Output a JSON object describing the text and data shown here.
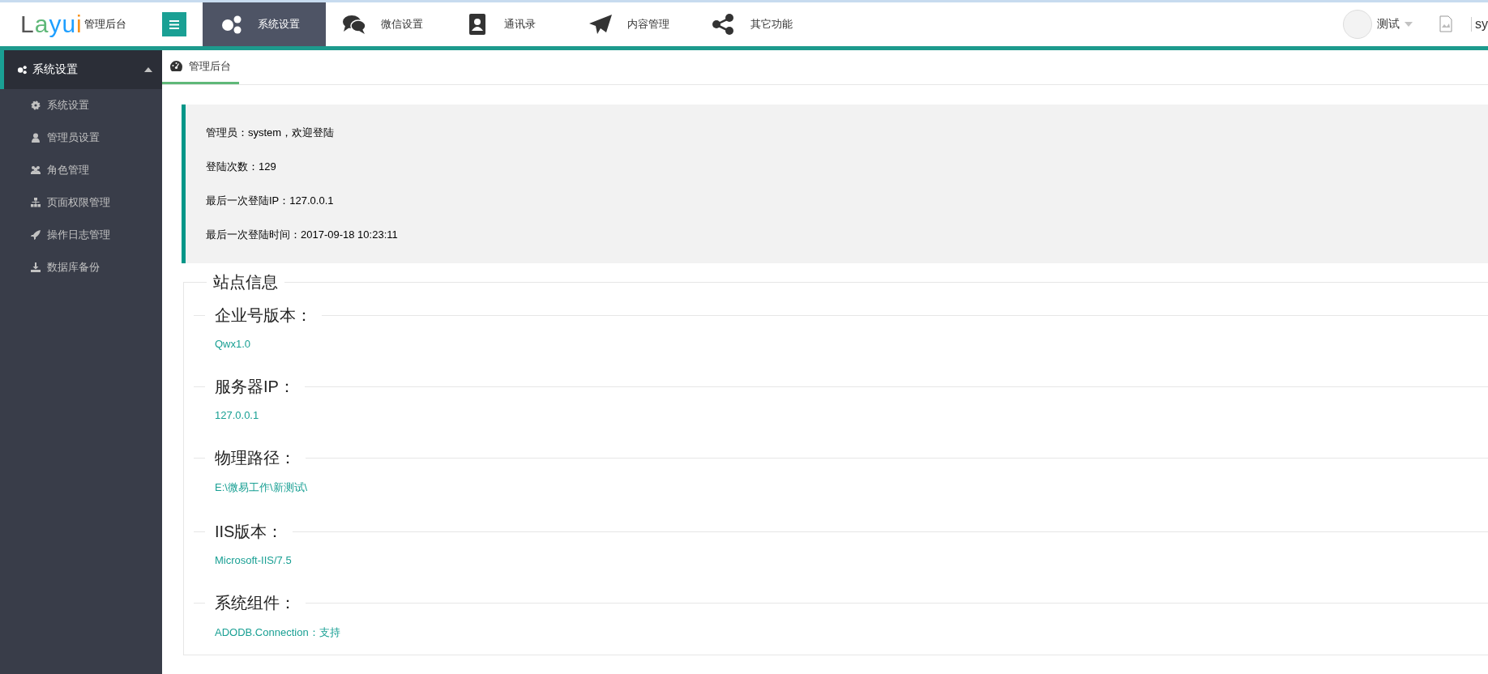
{
  "header": {
    "logo": "Layui",
    "logo_subtitle": "管理后台",
    "nav": [
      {
        "label": "系统设置",
        "selected": true
      },
      {
        "label": "微信设置",
        "selected": false
      },
      {
        "label": "通讯录",
        "selected": false
      },
      {
        "label": "内容管理",
        "selected": false
      },
      {
        "label": "其它功能",
        "selected": false
      }
    ],
    "user_menu": {
      "label": "测试",
      "user": "sy"
    }
  },
  "sidebar": {
    "groups": [
      {
        "label": "系统设置",
        "expanded": true,
        "children": [
          {
            "label": "系统设置"
          },
          {
            "label": "管理员设置"
          },
          {
            "label": "角色管理"
          },
          {
            "label": "页面权限管理"
          },
          {
            "label": "操作日志管理"
          },
          {
            "label": "数据库备份"
          }
        ]
      }
    ]
  },
  "tabs": [
    {
      "label": "管理后台",
      "selected": true
    }
  ],
  "welcome": [
    "管理员：system，欢迎登陆",
    "登陆次数：129",
    "最后一次登陆IP：127.0.0.1",
    "最后一次登陆时间：2017-09-18 10:23:11"
  ],
  "site_info": {
    "title": "站点信息",
    "fields": [
      {
        "label": "企业号版本：",
        "value": "Qwx1.0"
      },
      {
        "label": "服务器IP：",
        "value": "127.0.0.1"
      },
      {
        "label": "物理路径：",
        "value": "E:\\微易工作\\新测试\\"
      },
      {
        "label": "IIS版本：",
        "value": "Microsoft-IIS/7.5"
      },
      {
        "label": "系统组件：",
        "value": "ADODB.Connection：支持"
      }
    ]
  }
}
